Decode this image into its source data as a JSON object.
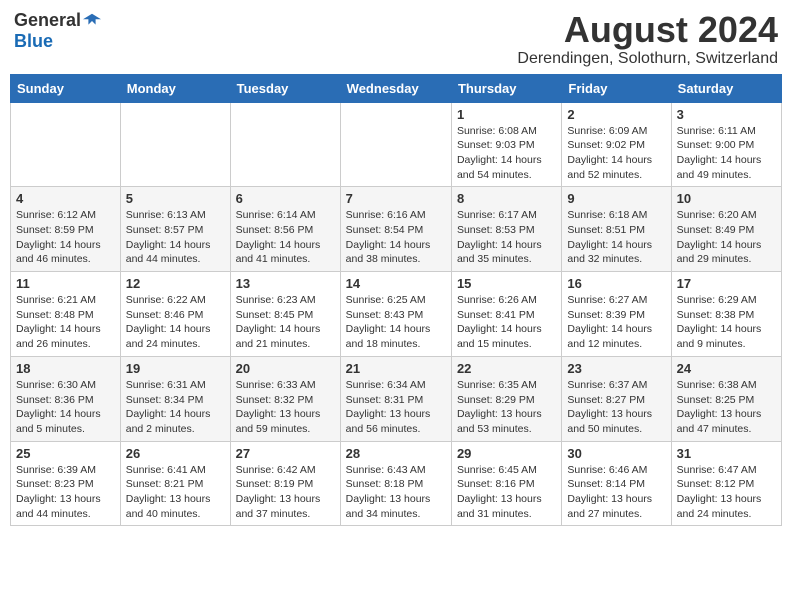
{
  "logo": {
    "general": "General",
    "blue": "Blue"
  },
  "title": "August 2024",
  "location": "Derendingen, Solothurn, Switzerland",
  "days_of_week": [
    "Sunday",
    "Monday",
    "Tuesday",
    "Wednesday",
    "Thursday",
    "Friday",
    "Saturday"
  ],
  "weeks": [
    [
      {
        "day": "",
        "info": ""
      },
      {
        "day": "",
        "info": ""
      },
      {
        "day": "",
        "info": ""
      },
      {
        "day": "",
        "info": ""
      },
      {
        "day": "1",
        "info": "Sunrise: 6:08 AM\nSunset: 9:03 PM\nDaylight: 14 hours\nand 54 minutes."
      },
      {
        "day": "2",
        "info": "Sunrise: 6:09 AM\nSunset: 9:02 PM\nDaylight: 14 hours\nand 52 minutes."
      },
      {
        "day": "3",
        "info": "Sunrise: 6:11 AM\nSunset: 9:00 PM\nDaylight: 14 hours\nand 49 minutes."
      }
    ],
    [
      {
        "day": "4",
        "info": "Sunrise: 6:12 AM\nSunset: 8:59 PM\nDaylight: 14 hours\nand 46 minutes."
      },
      {
        "day": "5",
        "info": "Sunrise: 6:13 AM\nSunset: 8:57 PM\nDaylight: 14 hours\nand 44 minutes."
      },
      {
        "day": "6",
        "info": "Sunrise: 6:14 AM\nSunset: 8:56 PM\nDaylight: 14 hours\nand 41 minutes."
      },
      {
        "day": "7",
        "info": "Sunrise: 6:16 AM\nSunset: 8:54 PM\nDaylight: 14 hours\nand 38 minutes."
      },
      {
        "day": "8",
        "info": "Sunrise: 6:17 AM\nSunset: 8:53 PM\nDaylight: 14 hours\nand 35 minutes."
      },
      {
        "day": "9",
        "info": "Sunrise: 6:18 AM\nSunset: 8:51 PM\nDaylight: 14 hours\nand 32 minutes."
      },
      {
        "day": "10",
        "info": "Sunrise: 6:20 AM\nSunset: 8:49 PM\nDaylight: 14 hours\nand 29 minutes."
      }
    ],
    [
      {
        "day": "11",
        "info": "Sunrise: 6:21 AM\nSunset: 8:48 PM\nDaylight: 14 hours\nand 26 minutes."
      },
      {
        "day": "12",
        "info": "Sunrise: 6:22 AM\nSunset: 8:46 PM\nDaylight: 14 hours\nand 24 minutes."
      },
      {
        "day": "13",
        "info": "Sunrise: 6:23 AM\nSunset: 8:45 PM\nDaylight: 14 hours\nand 21 minutes."
      },
      {
        "day": "14",
        "info": "Sunrise: 6:25 AM\nSunset: 8:43 PM\nDaylight: 14 hours\nand 18 minutes."
      },
      {
        "day": "15",
        "info": "Sunrise: 6:26 AM\nSunset: 8:41 PM\nDaylight: 14 hours\nand 15 minutes."
      },
      {
        "day": "16",
        "info": "Sunrise: 6:27 AM\nSunset: 8:39 PM\nDaylight: 14 hours\nand 12 minutes."
      },
      {
        "day": "17",
        "info": "Sunrise: 6:29 AM\nSunset: 8:38 PM\nDaylight: 14 hours\nand 9 minutes."
      }
    ],
    [
      {
        "day": "18",
        "info": "Sunrise: 6:30 AM\nSunset: 8:36 PM\nDaylight: 14 hours\nand 5 minutes."
      },
      {
        "day": "19",
        "info": "Sunrise: 6:31 AM\nSunset: 8:34 PM\nDaylight: 14 hours\nand 2 minutes."
      },
      {
        "day": "20",
        "info": "Sunrise: 6:33 AM\nSunset: 8:32 PM\nDaylight: 13 hours\nand 59 minutes."
      },
      {
        "day": "21",
        "info": "Sunrise: 6:34 AM\nSunset: 8:31 PM\nDaylight: 13 hours\nand 56 minutes."
      },
      {
        "day": "22",
        "info": "Sunrise: 6:35 AM\nSunset: 8:29 PM\nDaylight: 13 hours\nand 53 minutes."
      },
      {
        "day": "23",
        "info": "Sunrise: 6:37 AM\nSunset: 8:27 PM\nDaylight: 13 hours\nand 50 minutes."
      },
      {
        "day": "24",
        "info": "Sunrise: 6:38 AM\nSunset: 8:25 PM\nDaylight: 13 hours\nand 47 minutes."
      }
    ],
    [
      {
        "day": "25",
        "info": "Sunrise: 6:39 AM\nSunset: 8:23 PM\nDaylight: 13 hours\nand 44 minutes."
      },
      {
        "day": "26",
        "info": "Sunrise: 6:41 AM\nSunset: 8:21 PM\nDaylight: 13 hours\nand 40 minutes."
      },
      {
        "day": "27",
        "info": "Sunrise: 6:42 AM\nSunset: 8:19 PM\nDaylight: 13 hours\nand 37 minutes."
      },
      {
        "day": "28",
        "info": "Sunrise: 6:43 AM\nSunset: 8:18 PM\nDaylight: 13 hours\nand 34 minutes."
      },
      {
        "day": "29",
        "info": "Sunrise: 6:45 AM\nSunset: 8:16 PM\nDaylight: 13 hours\nand 31 minutes."
      },
      {
        "day": "30",
        "info": "Sunrise: 6:46 AM\nSunset: 8:14 PM\nDaylight: 13 hours\nand 27 minutes."
      },
      {
        "day": "31",
        "info": "Sunrise: 6:47 AM\nSunset: 8:12 PM\nDaylight: 13 hours\nand 24 minutes."
      }
    ]
  ]
}
